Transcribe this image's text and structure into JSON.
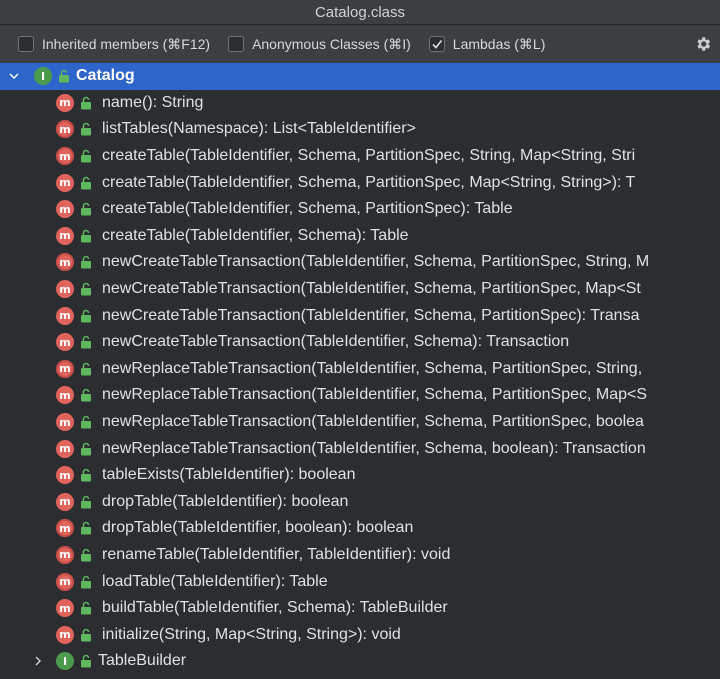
{
  "window": {
    "title": "Catalog.class"
  },
  "options": {
    "inherited": {
      "label": "Inherited members (⌘F12)",
      "checked": false
    },
    "anonymous": {
      "label": "Anonymous Classes (⌘I)",
      "checked": false
    },
    "lambdas": {
      "label": "Lambdas (⌘L)",
      "checked": true
    },
    "settings_icon": "gear-icon"
  },
  "tree": {
    "root": {
      "label": "Catalog",
      "icon": "interface-icon",
      "expanded": true
    },
    "members": [
      {
        "label": "name(): String",
        "abstract": false
      },
      {
        "label": "listTables(Namespace): List<TableIdentifier>",
        "abstract": true
      },
      {
        "label": "createTable(TableIdentifier, Schema, PartitionSpec, String, Map<String, Stri",
        "abstract": true
      },
      {
        "label": "createTable(TableIdentifier, Schema, PartitionSpec, Map<String, String>): T",
        "abstract": false
      },
      {
        "label": "createTable(TableIdentifier, Schema, PartitionSpec): Table",
        "abstract": false
      },
      {
        "label": "createTable(TableIdentifier, Schema): Table",
        "abstract": false
      },
      {
        "label": "newCreateTableTransaction(TableIdentifier, Schema, PartitionSpec, String, M",
        "abstract": true
      },
      {
        "label": "newCreateTableTransaction(TableIdentifier, Schema, PartitionSpec, Map<St",
        "abstract": false
      },
      {
        "label": "newCreateTableTransaction(TableIdentifier, Schema, PartitionSpec): Transa",
        "abstract": false
      },
      {
        "label": "newCreateTableTransaction(TableIdentifier, Schema): Transaction",
        "abstract": false
      },
      {
        "label": "newReplaceTableTransaction(TableIdentifier, Schema, PartitionSpec, String,",
        "abstract": true
      },
      {
        "label": "newReplaceTableTransaction(TableIdentifier, Schema, PartitionSpec, Map<S",
        "abstract": false
      },
      {
        "label": "newReplaceTableTransaction(TableIdentifier, Schema, PartitionSpec, boolea",
        "abstract": false
      },
      {
        "label": "newReplaceTableTransaction(TableIdentifier, Schema, boolean): Transaction",
        "abstract": false
      },
      {
        "label": "tableExists(TableIdentifier): boolean",
        "abstract": false
      },
      {
        "label": "dropTable(TableIdentifier): boolean",
        "abstract": false
      },
      {
        "label": "dropTable(TableIdentifier, boolean): boolean",
        "abstract": true
      },
      {
        "label": "renameTable(TableIdentifier, TableIdentifier): void",
        "abstract": true
      },
      {
        "label": "loadTable(TableIdentifier): Table",
        "abstract": true
      },
      {
        "label": "buildTable(TableIdentifier, Schema): TableBuilder",
        "abstract": false
      },
      {
        "label": "initialize(String, Map<String, String>): void",
        "abstract": false
      }
    ],
    "child": {
      "label": "TableBuilder",
      "icon": "interface-icon",
      "expanded": false
    }
  },
  "colors": {
    "background": "#2b2d30",
    "toolbar": "#3c3f41",
    "selection": "#2e65ca",
    "method_badge": "#e0635c",
    "interface_badge": "#4c9a4c",
    "lock": "#5fb85f"
  }
}
